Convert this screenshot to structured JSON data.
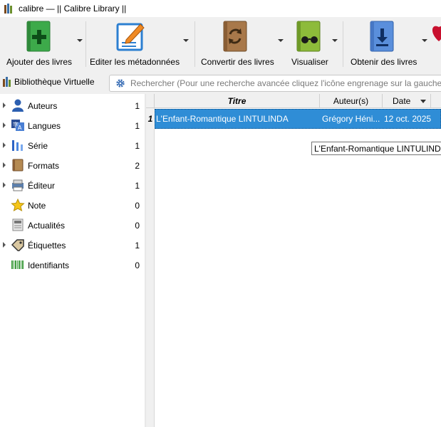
{
  "window": {
    "title": "calibre — || Calibre Library ||"
  },
  "toolbar": {
    "buttons": [
      {
        "label": "Ajouter des livres",
        "icon": "add-book-icon"
      },
      {
        "label": "Editer les métadonnées",
        "icon": "edit-metadata-icon"
      },
      {
        "label": "Convertir des livres",
        "icon": "convert-book-icon"
      },
      {
        "label": "Visualiser",
        "icon": "view-book-icon"
      },
      {
        "label": "Obtenir des livres",
        "icon": "get-books-icon"
      }
    ]
  },
  "virtual_library": {
    "label": "Bibliothèque Virtuelle"
  },
  "search": {
    "placeholder": "Rechercher (Pour une recherche avancée cliquez l'icône engrenage sur la gauche)"
  },
  "tag_browser": {
    "items": [
      {
        "label": "Auteurs",
        "count": "1",
        "icon": "authors-icon"
      },
      {
        "label": "Langues",
        "count": "1",
        "icon": "languages-icon"
      },
      {
        "label": "Série",
        "count": "1",
        "icon": "series-icon"
      },
      {
        "label": "Formats",
        "count": "2",
        "icon": "formats-icon"
      },
      {
        "label": "Éditeur",
        "count": "1",
        "icon": "publisher-icon"
      },
      {
        "label": "Note",
        "count": "0",
        "icon": "rating-star-icon"
      },
      {
        "label": "Actualités",
        "count": "0",
        "icon": "news-icon"
      },
      {
        "label": "Étiquettes",
        "count": "1",
        "icon": "tags-icon"
      },
      {
        "label": "Identifiants",
        "count": "0",
        "icon": "identifiers-barcode-icon"
      }
    ]
  },
  "book_list": {
    "columns": [
      "Titre",
      "Auteur(s)",
      "Date"
    ],
    "rows": [
      {
        "number": "1",
        "title": "L'Enfant-Romantique LINTULINDA",
        "authors": "Grégory Héni...",
        "date": "12 oct. 2025"
      }
    ]
  },
  "tooltip": {
    "text": "L'Enfant-Romantique LINTULINDA"
  },
  "colors": {
    "selection": "#2f8dd6",
    "toolbar_bg": "#f0f0f0"
  }
}
